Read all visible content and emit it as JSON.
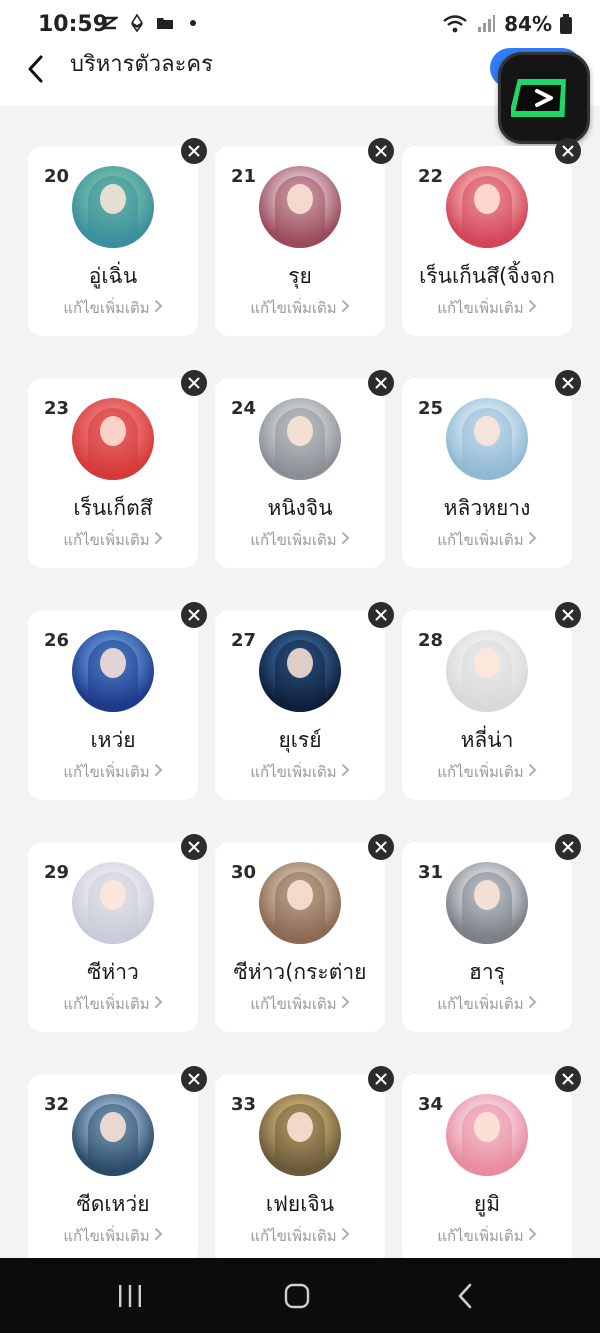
{
  "status": {
    "time": "10:59",
    "battery": "84%"
  },
  "header": {
    "title": "บริหารตัวละคร"
  },
  "edit_label": "แก้ไขเพิ่มเติม",
  "cards": [
    {
      "num": "20",
      "name": "อู่เฉิ่น",
      "colors": [
        "#3a8f9e",
        "#7cc4a8"
      ]
    },
    {
      "num": "21",
      "name": "รุย",
      "colors": [
        "#9a4a5a",
        "#e8d0d8"
      ]
    },
    {
      "num": "22",
      "name": "เร็นเก็นสึ(จิ้งจก",
      "colors": [
        "#d4455a",
        "#f5b8b8"
      ]
    },
    {
      "num": "23",
      "name": "เร็นเก็ตสึ",
      "colors": [
        "#d63a3a",
        "#f08080"
      ]
    },
    {
      "num": "24",
      "name": "หนิงจิน",
      "colors": [
        "#8a8f96",
        "#d8dcdf"
      ]
    },
    {
      "num": "25",
      "name": "หลิวหยาง",
      "colors": [
        "#8fb8d4",
        "#e0eef6"
      ]
    },
    {
      "num": "26",
      "name": "เหว่ย",
      "colors": [
        "#1e3a8a",
        "#6aa0e0"
      ]
    },
    {
      "num": "27",
      "name": "ยุเรย์",
      "colors": [
        "#0f1f3a",
        "#3a6aa0"
      ]
    },
    {
      "num": "28",
      "name": "หลี่น่า",
      "colors": [
        "#d8d8d8",
        "#f4f4f4"
      ]
    },
    {
      "num": "29",
      "name": "ซีห่าว",
      "colors": [
        "#c8ccd8",
        "#f0f0f4"
      ]
    },
    {
      "num": "30",
      "name": "ซีห่าว(กระต่าย",
      "colors": [
        "#8a6a52",
        "#d8c4b0"
      ]
    },
    {
      "num": "31",
      "name": "ฮารุ",
      "colors": [
        "#7a7f88",
        "#e4e6ea"
      ]
    },
    {
      "num": "32",
      "name": "ซีดเหว่ย",
      "colors": [
        "#2a4a6a",
        "#a8c4dc"
      ]
    },
    {
      "num": "33",
      "name": "เฟยเจิน",
      "colors": [
        "#6a5a3a",
        "#d8b87a"
      ]
    },
    {
      "num": "34",
      "name": "ยูมิ",
      "colors": [
        "#e88aa0",
        "#f8e0e8"
      ]
    }
  ]
}
